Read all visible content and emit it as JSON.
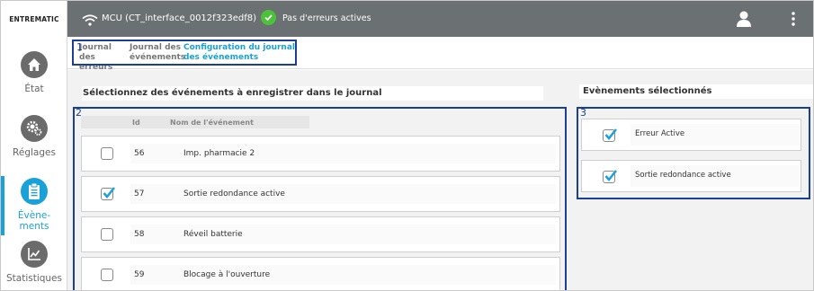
{
  "app": {
    "logo_text": "ENTREMATIC"
  },
  "sidebar": {
    "items": [
      {
        "label": "État",
        "icon": "home-icon",
        "active": false
      },
      {
        "label": "Réglages",
        "icon": "gears-icon",
        "active": false
      },
      {
        "label": "Évène-\nments",
        "icon": "clipboard-icon",
        "active": true
      },
      {
        "label": "Statistiques",
        "icon": "chart-icon",
        "active": false
      }
    ]
  },
  "header": {
    "device_label": "MCU (CT_interface_0012f323edf8)",
    "status_label": "Pas d'erreurs actives"
  },
  "tabs": [
    {
      "label": "Journal des erreurs",
      "active": false
    },
    {
      "label": "Journal des événements",
      "active": false
    },
    {
      "label": "Configuration du journal des événements",
      "active": true
    }
  ],
  "callouts": [
    "1",
    "2",
    "3"
  ],
  "left_panel": {
    "title": "Sélectionnez des événements à enregistrer dans le journal",
    "columns": {
      "id": "Id",
      "name": "Nom de l'événement"
    },
    "rows": [
      {
        "id": "56",
        "name": "Imp. pharmacie 2",
        "checked": false
      },
      {
        "id": "57",
        "name": "Sortie redondance active",
        "checked": true
      },
      {
        "id": "58",
        "name": "Réveil batterie",
        "checked": false
      },
      {
        "id": "59",
        "name": "Blocage à l'ouverture",
        "checked": false
      }
    ]
  },
  "right_panel": {
    "title": "Evènements sélectionnés",
    "items": [
      {
        "name": "Erreur Active",
        "checked": true
      },
      {
        "name": "Sortie redondance active",
        "checked": true
      }
    ]
  },
  "colors": {
    "accent": "#1aa1d8",
    "header_bg": "#6b7173",
    "callout_border": "#1b3f94",
    "status_ok": "#4cc23a"
  }
}
